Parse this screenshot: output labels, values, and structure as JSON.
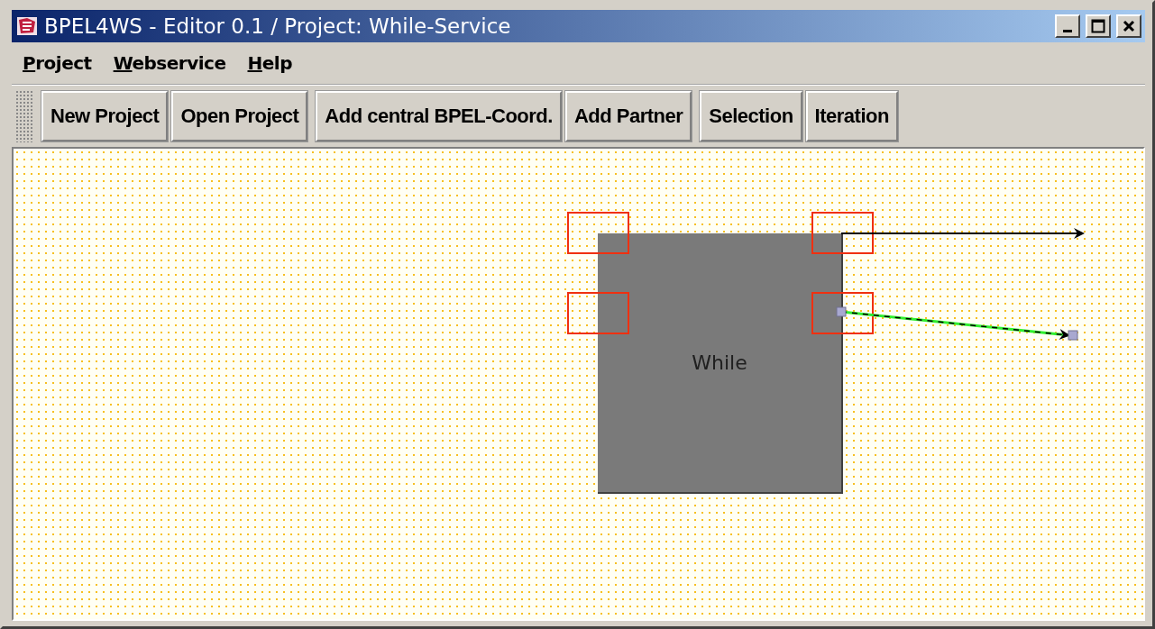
{
  "window": {
    "title": "BPEL4WS - Editor 0.1 / Project: While-Service"
  },
  "menu": [
    "Project",
    "Webservice",
    "Help"
  ],
  "toolbar": [
    [
      "New Project",
      "Open Project"
    ],
    [
      "Add central BPEL-Coord.",
      "Add Partner"
    ],
    [
      "Selection",
      "Iteration"
    ]
  ],
  "canvas": {
    "node": {
      "label": "While"
    }
  }
}
